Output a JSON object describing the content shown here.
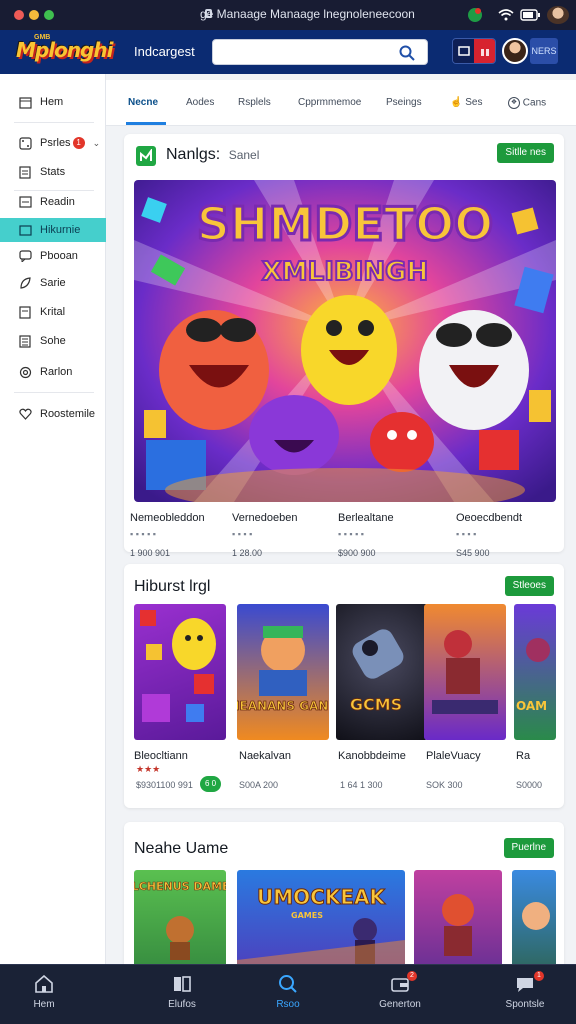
{
  "browser": {
    "url": "ge Manaage Manaage lnegnoleneecoon"
  },
  "header": {
    "logo_text": "Mplonghi",
    "logo_tag": "GMB",
    "label": "Indcargest",
    "search_placeholder": "",
    "account_label": "NERS"
  },
  "sidebar": {
    "items": [
      {
        "label": "Hem",
        "icon": "calendar-icon"
      },
      {
        "label": "Psrles",
        "icon": "dice-icon",
        "badge": "1"
      },
      {
        "label": "Stats",
        "icon": "document-icon"
      },
      {
        "label": "Readin",
        "icon": "list-icon"
      },
      {
        "label": "Hikurnie",
        "icon": "folder-icon"
      },
      {
        "label": "Pbooan",
        "icon": "chat-icon"
      },
      {
        "label": "Sarie",
        "icon": "leaf-icon"
      },
      {
        "label": "Krital",
        "icon": "document-icon"
      },
      {
        "label": "Sohe",
        "icon": "list-icon"
      },
      {
        "label": "Rarlon",
        "icon": "gear-icon"
      },
      {
        "label": "Roostemile",
        "icon": "heart-icon"
      }
    ]
  },
  "tabs": [
    {
      "label": "Necne"
    },
    {
      "label": "Aodes"
    },
    {
      "label": "Rsplels"
    },
    {
      "label": "Cpprmmemoe"
    },
    {
      "label": "Pseings"
    },
    {
      "label": "Ses"
    },
    {
      "label": "Cans"
    }
  ],
  "featured": {
    "title": "Nanlgs:",
    "subtitle": "Sanel",
    "more_label": "Sitlle nes",
    "hero_title_line1": "SHMDETOO",
    "hero_title_line2": "XMLIBINGH",
    "stats": [
      {
        "name": "Nemeobleddon",
        "sub": "▪ ▪ ▪ ▪ ▪",
        "value": "1 900 901"
      },
      {
        "name": "Vernedoeben",
        "sub": "▪ ▪ ▪ ▪",
        "value": "1 28.00"
      },
      {
        "name": "Berlealtane",
        "sub": "▪ ▪ ▪ ▪ ▪",
        "value": "$900 900"
      },
      {
        "name": "Oeoecdbendt",
        "sub": "▪ ▪ ▪ ▪",
        "value": "S45 900"
      }
    ]
  },
  "section2": {
    "title": "Hiburst lrgl",
    "more_label": "Stleoes",
    "items": [
      {
        "name": "Bleocltiann",
        "sub": "★★★",
        "value": "$9301100 991",
        "badge": "6 0"
      },
      {
        "name": "Naekalvan",
        "sub": "",
        "value": "S00A 200",
        "thumb_text": "NEANANS GANE"
      },
      {
        "name": "Kanobbdeime",
        "sub": "",
        "value": "1 64 1 300",
        "thumb_text": "GCMS"
      },
      {
        "name": "PlaleVuacy",
        "sub": "",
        "value": "SOK 300",
        "thumb_text": ""
      },
      {
        "name": "Ra",
        "sub": "",
        "value": "S0000",
        "thumb_text": "OAM"
      }
    ]
  },
  "section3": {
    "title": "Neahe Uame",
    "more_label": "Puerlne",
    "thumb1_text": "NLCHENUS DAMES",
    "thumb2_text": "UMOCKEAK",
    "thumb2_sub": "GAMES"
  },
  "bottom_nav": [
    {
      "label": "Hem",
      "icon": "home-icon"
    },
    {
      "label": "Elufos",
      "icon": "book-icon"
    },
    {
      "label": "Rsoo",
      "icon": "search-icon"
    },
    {
      "label": "Generton",
      "icon": "wallet-icon",
      "badge": "2"
    },
    {
      "label": "Spontsle",
      "icon": "chat-bubble-icon",
      "badge": "1"
    }
  ],
  "colors": {
    "header_bg": "#0b2b72",
    "accent": "#45cfcc",
    "button_green": "#1d9a3c",
    "bottom_bg": "#1a2236"
  }
}
